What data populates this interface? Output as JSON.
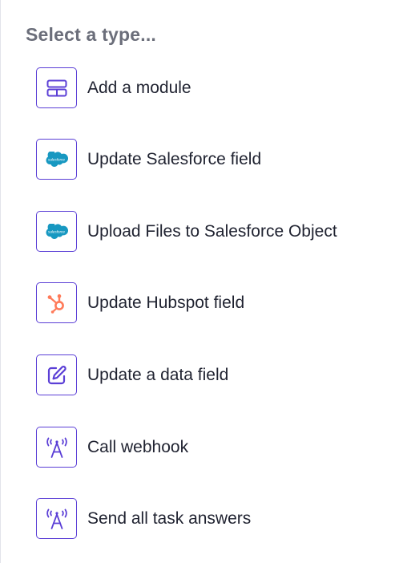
{
  "header": {
    "title": "Select a type..."
  },
  "options": [
    {
      "label": "Add a module",
      "icon": "module-icon"
    },
    {
      "label": "Update Salesforce field",
      "icon": "salesforce-icon"
    },
    {
      "label": "Upload Files to Salesforce Object",
      "icon": "salesforce-icon"
    },
    {
      "label": "Update Hubspot field",
      "icon": "hubspot-icon"
    },
    {
      "label": "Update a data field",
      "icon": "edit-icon"
    },
    {
      "label": "Call webhook",
      "icon": "webhook-icon"
    },
    {
      "label": "Send all task answers",
      "icon": "webhook-icon"
    }
  ],
  "colors": {
    "accent": "#5b3fd6",
    "salesforce": "#1798c1",
    "hubspot": "#ff7a59",
    "heading": "#6b6e7a",
    "text": "#1f2230"
  }
}
